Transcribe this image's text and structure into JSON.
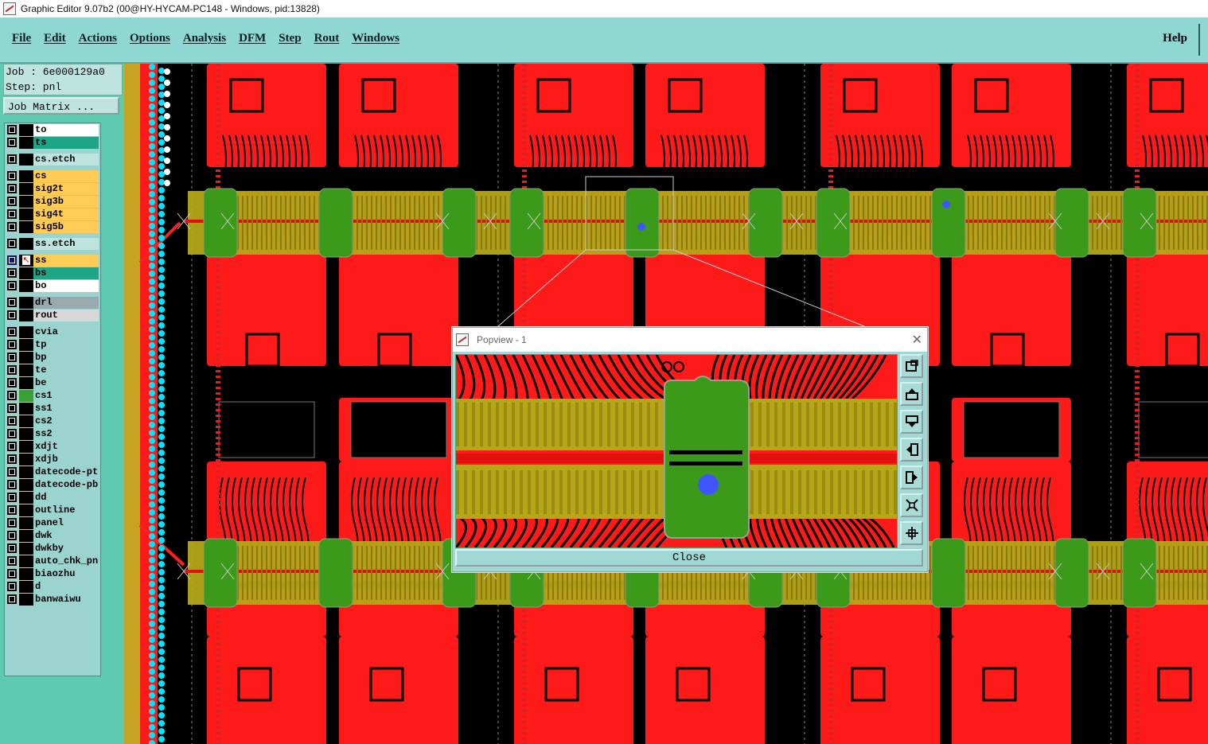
{
  "window": {
    "title": "Graphic Editor 9.07b2 (00@HY-HYCAM-PC148 - Windows, pid:13828)"
  },
  "menu": {
    "items": [
      "File",
      "Edit",
      "Actions",
      "Options",
      "Analysis",
      "DFM",
      "Step",
      "Rout",
      "Windows"
    ],
    "help": "Help"
  },
  "job": {
    "job_line": "Job : 6e000129a0",
    "step_line": "Step: pnl",
    "matrix_button": "Job Matrix ..."
  },
  "layers": [
    {
      "name": "to",
      "color": "#ffffff"
    },
    {
      "name": "ts",
      "color": "#1ea587"
    },
    {
      "name": "cs.etch",
      "color": "#bfe3df"
    },
    {
      "name": "cs",
      "color": "#ffcc55"
    },
    {
      "name": "sig2t",
      "color": "#ffcc55"
    },
    {
      "name": "sig3b",
      "color": "#ffcc55"
    },
    {
      "name": "sig4t",
      "color": "#ffcc55"
    },
    {
      "name": "sig5b",
      "color": "#ffcc55"
    },
    {
      "name": "ss.etch",
      "color": "#bfe3df"
    },
    {
      "name": "ss",
      "color": "#ffcc55"
    },
    {
      "name": "bs",
      "color": "#1ea587"
    },
    {
      "name": "bo",
      "color": "#ffffff"
    },
    {
      "name": "drl",
      "color": "#9aa9ad"
    },
    {
      "name": "rout",
      "color": "#d8d8d8"
    },
    {
      "name": "cvia",
      "color": "#9bd4cf"
    },
    {
      "name": "tp",
      "color": "#9bd4cf"
    },
    {
      "name": "bp",
      "color": "#9bd4cf"
    },
    {
      "name": "te",
      "color": "#9bd4cf"
    },
    {
      "name": "be",
      "color": "#9bd4cf"
    },
    {
      "name": "cs1",
      "color": "#9bd4cf"
    },
    {
      "name": "ss1",
      "color": "#9bd4cf"
    },
    {
      "name": "cs2",
      "color": "#9bd4cf"
    },
    {
      "name": "ss2",
      "color": "#9bd4cf"
    },
    {
      "name": "xdjt",
      "color": "#9bd4cf"
    },
    {
      "name": "xdjb",
      "color": "#9bd4cf"
    },
    {
      "name": "datecode-ptc",
      "color": "#9bd4cf"
    },
    {
      "name": "datecode-pbc",
      "color": "#9bd4cf"
    },
    {
      "name": "dd",
      "color": "#9bd4cf"
    },
    {
      "name": "outline",
      "color": "#9bd4cf"
    },
    {
      "name": "panel",
      "color": "#9bd4cf"
    },
    {
      "name": "dwk",
      "color": "#9bd4cf"
    },
    {
      "name": "dwkby",
      "color": "#9bd4cf"
    },
    {
      "name": "auto_chk_pnl",
      "color": "#9bd4cf"
    },
    {
      "name": "biaozhu",
      "color": "#9bd4cf"
    },
    {
      "name": "d",
      "color": "#9bd4cf"
    },
    {
      "name": "banwaiwu",
      "color": "#9bd4cf"
    }
  ],
  "popview": {
    "title": "Popview - 1",
    "close_label": "Close"
  },
  "colors": {
    "copper": "#ff1a1a",
    "pad_green": "#3c9a1a",
    "gold": "#b5a718",
    "cyan": "#00e5ff"
  }
}
